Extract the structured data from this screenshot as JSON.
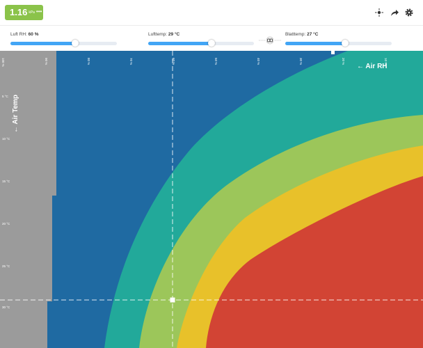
{
  "header": {
    "vpd_value": "1.16",
    "vpd_unit": "kPa",
    "vpd_more": "•••",
    "icons": [
      "target-icon",
      "share-icon",
      "gear-icon"
    ]
  },
  "sliders": [
    {
      "id": "air-rh",
      "label": "Luft RH:",
      "value": "60 %",
      "fill_fraction": 0.61
    },
    {
      "id": "air-temp",
      "label": "Lufttemp:",
      "value": "29 °C",
      "fill_fraction": 0.6
    },
    {
      "id": "leaf-temp",
      "label": "Blatttemp:",
      "value": "27 °C",
      "fill_fraction": 0.56
    }
  ],
  "chart": {
    "rh_axis_title": "← Air RH",
    "temp_axis_title": "← Air Temp",
    "rh_ticks": [
      "100 %",
      "90 %",
      "80 %",
      "70 %",
      "60 %",
      "50 %",
      "40 %",
      "30 %",
      "20 %",
      "10 %"
    ],
    "temp_ticks": [
      "5 °C",
      "10 °C",
      "15 °C",
      "20 °C",
      "25 °C",
      "30 °C"
    ]
  },
  "colors": {
    "accent": "#42a5f5",
    "badge": "#8bc34a",
    "zone_gray": "#9b9b9b",
    "zone_dark_blue": "#1f6aa2",
    "zone_teal": "#22a99a",
    "zone_light_green": "#9cc65a",
    "zone_yellow": "#e8c12a",
    "zone_red": "#d24434"
  }
}
